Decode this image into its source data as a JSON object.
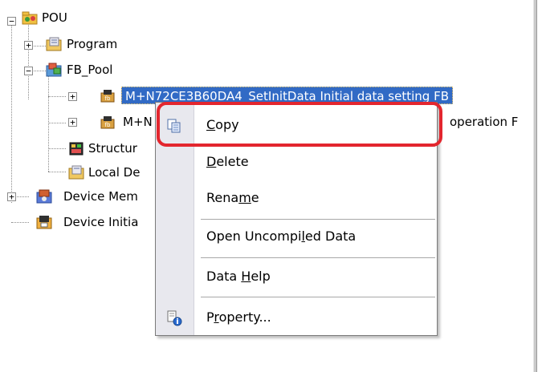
{
  "tree": {
    "pou": {
      "label": "POU",
      "expander": "−",
      "icon": "folder-project-icon"
    },
    "program": {
      "label": "Program",
      "expander": "+",
      "icon": "program-folder-icon"
    },
    "fb_pool": {
      "label": "FB_Pool",
      "expander": "−",
      "icon": "fb-pool-icon"
    },
    "fb1": {
      "label": "M+N72CE3B60DA4_SetInitData Initial data setting FB",
      "expander": "+",
      "icon": "function-block-icon"
    },
    "fb2": {
      "label": "M+N",
      "label_tail": "operation F",
      "expander": "+",
      "icon": "function-block-icon"
    },
    "structured": {
      "label": "Structur",
      "icon": "structure-icon"
    },
    "local_device": {
      "label": "Local De",
      "icon": "local-device-icon"
    },
    "device_memory": {
      "label": "Device Mem",
      "expander": "+",
      "icon": "device-memory-icon"
    },
    "device_initial": {
      "label": "Device Initia",
      "icon": "device-initial-icon"
    }
  },
  "context_menu": {
    "items": [
      {
        "label_underlined": "C",
        "label_rest": "opy",
        "icon": "copy-icon"
      },
      {
        "label_underlined": "D",
        "label_rest": "elete"
      },
      {
        "label_pre": "Rena",
        "label_underlined": "m",
        "label_rest": "e"
      },
      {
        "label_pre": "Open Uncompi",
        "label_underlined": "l",
        "label_rest": "ed Data"
      },
      {
        "label_pre": "Data ",
        "label_underlined": "H",
        "label_rest": "elp"
      },
      {
        "label_pre": "P",
        "label_underlined": "r",
        "label_rest": "operty...",
        "icon": "property-icon"
      }
    ]
  },
  "highlight_color": "#e3262e",
  "selection_color": "#316ac5"
}
